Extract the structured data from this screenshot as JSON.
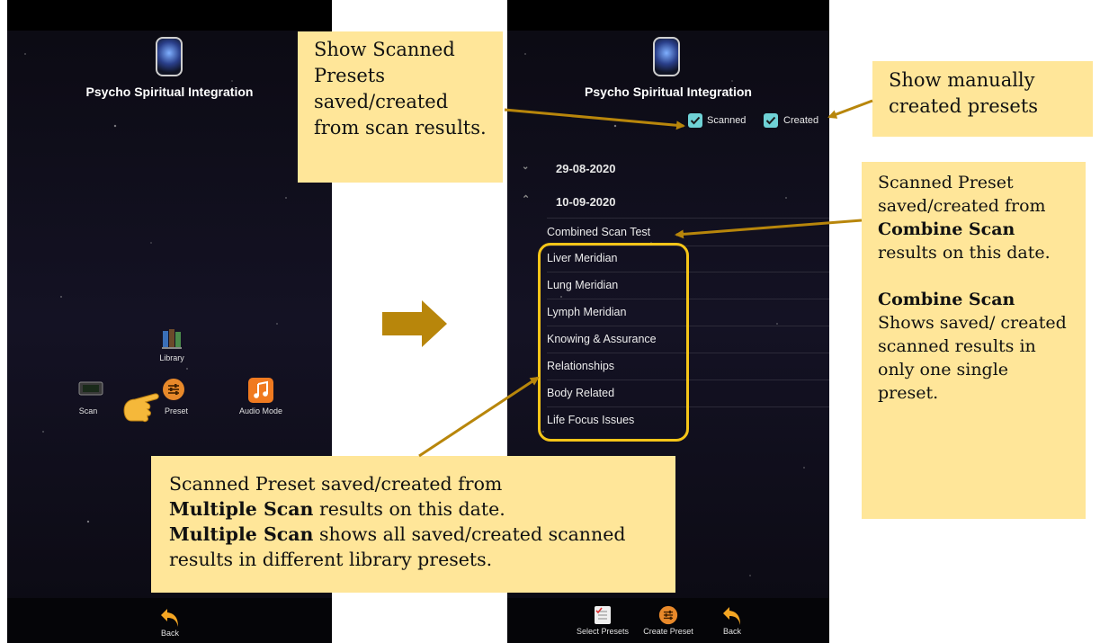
{
  "left_screen": {
    "app_title": "Psycho Spiritual Integration",
    "menu": {
      "library_label": "Library",
      "scan_label": "Scan",
      "preset_label": "Preset",
      "audio_mode_label": "Audio Mode"
    },
    "bottom": {
      "back_label": "Back"
    }
  },
  "right_screen": {
    "app_title": "Psycho Spiritual Integration",
    "filters": {
      "scanned_label": "Scanned",
      "created_label": "Created",
      "scanned_checked": true,
      "created_checked": true
    },
    "dates": [
      {
        "label": "29-08-2020",
        "expanded": false
      },
      {
        "label": "10-09-2020",
        "expanded": true
      }
    ],
    "presets": [
      "Combined Scan Test",
      "Liver Meridian",
      "Lung Meridian",
      "Lymph Meridian",
      "Knowing & Assurance",
      "Relationships",
      "Body Related",
      "Life Focus Issues"
    ],
    "bottom": {
      "select_presets_label": "Select Presets",
      "create_preset_label": "Create Preset",
      "back_label": "Back"
    }
  },
  "callouts": {
    "scanned_presets": "Show Scanned Presets saved/created from scan results.",
    "manual_presets": "Show manually created presets",
    "combine_scan": {
      "line1": "Scanned Preset saved/created from",
      "bold1": "Combine Scan",
      "line2": "results on this date.",
      "bold2": "Combine Scan",
      "line3": "Shows saved/ created scanned results in only one single preset."
    },
    "multiple_scan": {
      "line1": "Scanned Preset saved/created from",
      "bold1": "Multiple Scan",
      "line2": "results on this date.",
      "bold2": "Multiple Scan",
      "line3": "shows all saved/created scanned results in different library presets."
    }
  },
  "colors": {
    "callout_bg": "#ffe699",
    "arrow": "#b8860b",
    "highlight_box": "#f5c518",
    "checkbox": "#6fd2d6",
    "preset_icon": "#e8892a"
  },
  "icons": {
    "app_logo": "head-logo-icon",
    "library": "books-icon",
    "scan": "scanner-device-icon",
    "preset": "sliders-icon",
    "audio": "music-note-icon",
    "back": "back-arrow-icon",
    "select_presets": "checklist-icon",
    "hand": "pointing-hand-icon",
    "transition": "right-arrow-icon"
  }
}
